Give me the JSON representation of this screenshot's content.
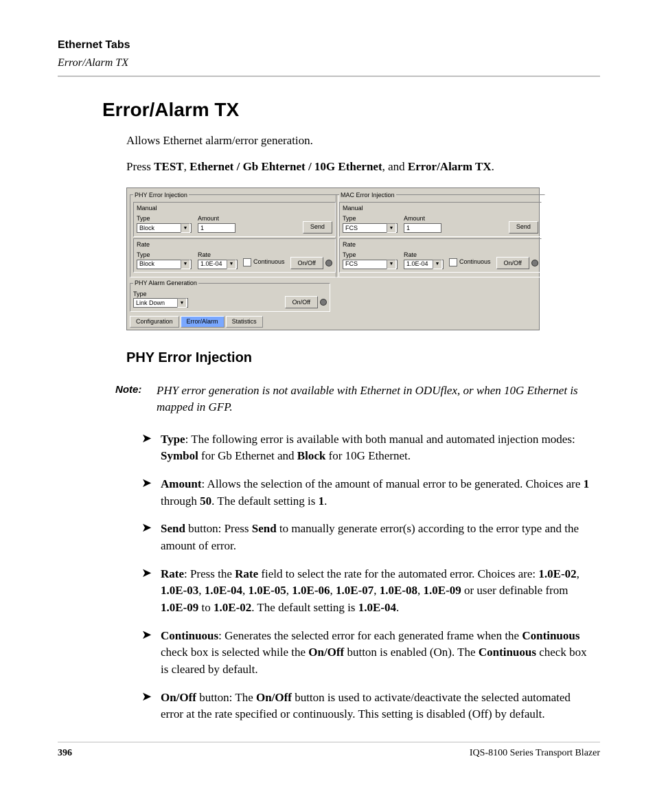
{
  "header": {
    "title": "Ethernet Tabs",
    "subtitle": "Error/Alarm TX"
  },
  "h1": "Error/Alarm TX",
  "intro": "Allows Ethernet alarm/error generation.",
  "nav": {
    "prefix": "Press ",
    "p1": "TEST",
    "sep1": ", ",
    "p2": "Ethernet / Gb Ehternet / 10G Ethernet",
    "sep2": ", and ",
    "p3": "Error/Alarm TX",
    "suffix": "."
  },
  "shot": {
    "phy_inj": {
      "legend": "PHY Error Injection",
      "manual": {
        "legend": "Manual",
        "type_label": "Type",
        "type_value": "Block",
        "amount_label": "Amount",
        "amount_value": "1",
        "send": "Send"
      },
      "rate": {
        "legend": "Rate",
        "type_label": "Type",
        "type_value": "Block",
        "rate_label": "Rate",
        "rate_value": "1.0E-04",
        "cont": "Continuous",
        "onoff": "On/Off"
      }
    },
    "phy_alarm": {
      "legend": "PHY Alarm Generation",
      "type_label": "Type",
      "type_value": "Link Down",
      "onoff": "On/Off"
    },
    "mac_inj": {
      "legend": "MAC Error Injection",
      "manual": {
        "legend": "Manual",
        "type_label": "Type",
        "type_value": "FCS",
        "amount_label": "Amount",
        "amount_value": "1",
        "send": "Send"
      },
      "rate": {
        "legend": "Rate",
        "type_label": "Type",
        "type_value": "FCS",
        "rate_label": "Rate",
        "rate_value": "1.0E-04",
        "cont": "Continuous",
        "onoff": "On/Off"
      }
    },
    "tabs": {
      "t1": "Configuration",
      "t2": "Error/Alarm",
      "t3": "Statistics"
    }
  },
  "h2": "PHY Error Injection",
  "note": {
    "label": "Note:",
    "text": "PHY error generation is not available with Ethernet in ODUflex, or when 10G Ethernet is mapped in GFP."
  },
  "bullets": {
    "b1": {
      "k1": "Type",
      "t1": ": The following error is available with both manual and automated injection modes: ",
      "k2": "Symbol",
      "t2": " for Gb Ethernet and ",
      "k3": "Block",
      "t3": " for 10G Ethernet."
    },
    "b2": {
      "k1": "Amount",
      "t1": ": Allows the selection of the amount of manual error to be generated. Choices are ",
      "k2": "1",
      "t2": " through ",
      "k3": "50",
      "t3": ". The default setting is ",
      "k4": "1",
      "t4": "."
    },
    "b3": {
      "k1": "Send",
      "t1": " button: Press ",
      "k2": "Send",
      "t2": " to manually generate error(s) according to the error type and the amount of error."
    },
    "b4": {
      "k1": "Rate",
      "t1": ": Press the ",
      "k2": "Rate",
      "t2": " field to select the rate for the automated error. Choices are: ",
      "k3": "1.0E-02",
      "s1": ", ",
      "k4": "1.0E-03",
      "s2": ", ",
      "k5": "1.0E-04",
      "s3": ", ",
      "k6": "1.0E-05",
      "s4": ", ",
      "k7": "1.0E-06",
      "s5": ", ",
      "k8": "1.0E-07",
      "s6": ", ",
      "k9": "1.0E-08",
      "s7": ", ",
      "k10": "1.0E-09",
      "t3": " or user definable from ",
      "k11": "1.0E-09",
      "t4": " to ",
      "k12": "1.0E-02",
      "t5": ". The default setting is ",
      "k13": "1.0E-04",
      "t6": "."
    },
    "b5": {
      "k1": "Continuous",
      "t1": ": Generates the selected error for each generated frame when the ",
      "k2": "Continuous",
      "t2": " check box is selected while the ",
      "k3": "On/Off",
      "t3": " button is enabled (On). The ",
      "k4": "Continuous",
      "t4": " check box is cleared by default."
    },
    "b6": {
      "k1": "On/Off",
      "t1": " button: The ",
      "k2": "On/Off",
      "t2": " button is used to activate/deactivate the selected automated error at the rate specified or continuously. This setting is disabled (Off) by default."
    }
  },
  "footer": {
    "page": "396",
    "product": "IQS-8100 Series Transport Blazer"
  }
}
